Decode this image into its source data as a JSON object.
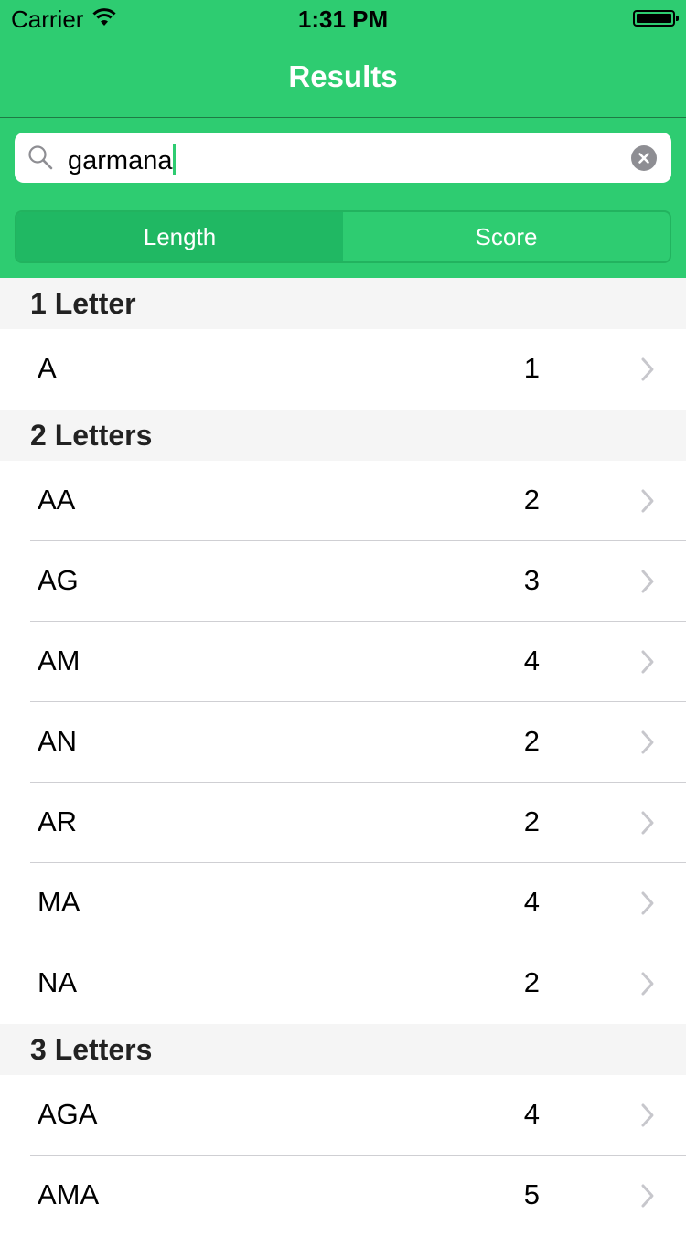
{
  "status_bar": {
    "carrier": "Carrier",
    "time": "1:31 PM"
  },
  "nav": {
    "title": "Results"
  },
  "search": {
    "value": "garmana"
  },
  "segments": {
    "length": "Length",
    "score": "Score",
    "selected": "Length"
  },
  "sections": [
    {
      "title": "1 Letter",
      "rows": [
        {
          "word": "A",
          "score": "1"
        }
      ]
    },
    {
      "title": "2 Letters",
      "rows": [
        {
          "word": "AA",
          "score": "2"
        },
        {
          "word": "AG",
          "score": "3"
        },
        {
          "word": "AM",
          "score": "4"
        },
        {
          "word": "AN",
          "score": "2"
        },
        {
          "word": "AR",
          "score": "2"
        },
        {
          "word": "MA",
          "score": "4"
        },
        {
          "word": "NA",
          "score": "2"
        }
      ]
    },
    {
      "title": "3 Letters",
      "rows": [
        {
          "word": "AGA",
          "score": "4"
        },
        {
          "word": "AMA",
          "score": "5"
        }
      ]
    }
  ],
  "colors": {
    "accent": "#2ecc71",
    "segment_selected": "#20b863"
  }
}
